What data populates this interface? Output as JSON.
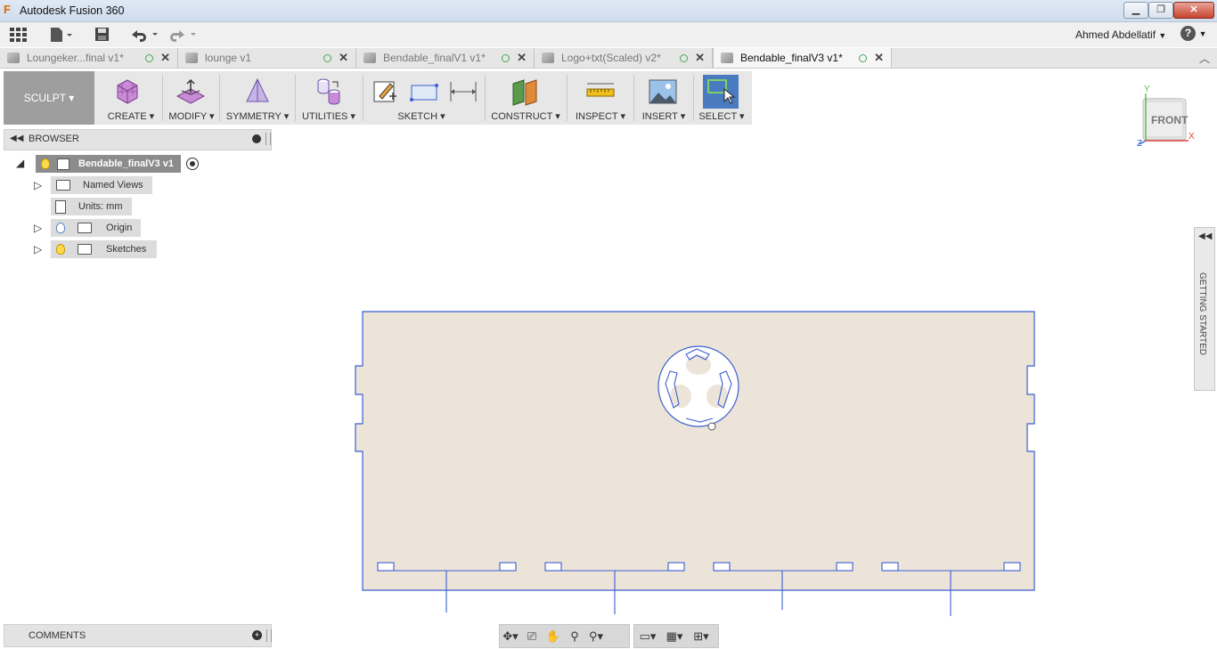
{
  "window": {
    "title": "Autodesk Fusion 360",
    "logo_letter": "F",
    "minimize": "▁",
    "restore": "❐",
    "close": "✕"
  },
  "toolbar": {
    "user_name": "Ahmed Abdellatif",
    "user_caret": "▼",
    "help": "?",
    "help_caret": "▼"
  },
  "tabs": [
    {
      "label": "Loungeker...final v1*",
      "active": false
    },
    {
      "label": "lounge v1",
      "active": false
    },
    {
      "label": "Bendable_finalV1 v1*",
      "active": false
    },
    {
      "label": "Logo+txt(Scaled) v2*",
      "active": false
    },
    {
      "label": "Bendable_finalV3 v1*",
      "active": true
    }
  ],
  "ribbon": {
    "workspace": "SCULPT ▾",
    "groups": {
      "create": "CREATE ▾",
      "modify": "MODIFY ▾",
      "symmetry": "SYMMETRY ▾",
      "utilities": "UTILITIES ▾",
      "sketch": "SKETCH ▾",
      "construct": "CONSTRUCT ▾",
      "inspect": "INSPECT ▾",
      "insert": "INSERT ▾",
      "select": "SELECT ▾"
    }
  },
  "browser": {
    "title": "BROWSER",
    "root": "Bendable_finalV3 v1",
    "items": {
      "named_views": "Named Views",
      "units": "Units: mm",
      "origin": "Origin",
      "sketches": "Sketches"
    }
  },
  "viewcube": {
    "face": "FRONT",
    "axis_x": "X",
    "axis_y": "Y",
    "axis_z": "Z"
  },
  "getting_started": {
    "label": "GETTING STARTED"
  },
  "comments": {
    "title": "COMMENTS"
  },
  "colors": {
    "sketch_line": "#3a5fd1",
    "profile_fill": "#ede4d9",
    "accent_select": "#4a7bc0"
  }
}
